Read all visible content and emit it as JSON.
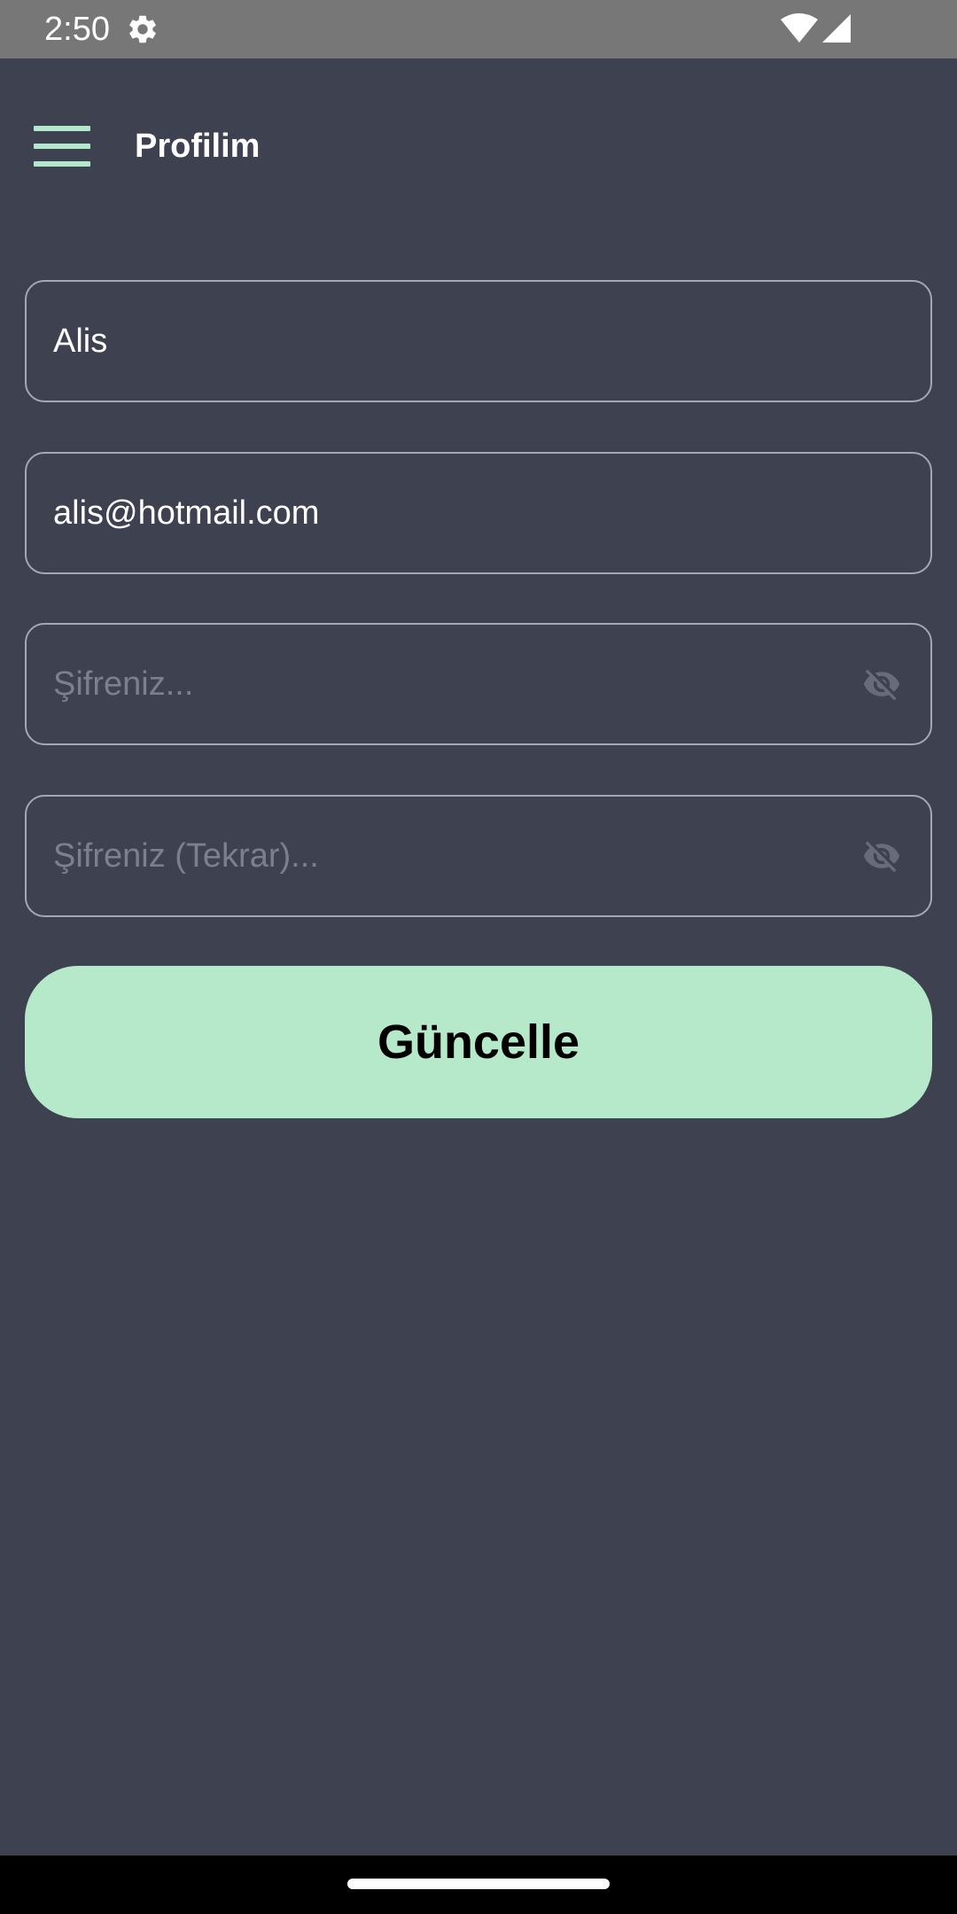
{
  "status_bar": {
    "time": "2:50",
    "icons": [
      "gear-icon",
      "wifi-icon",
      "cell-signal-icon"
    ]
  },
  "app_bar": {
    "title": "Profilim",
    "menu_icon": "hamburger-menu-icon"
  },
  "form": {
    "name_field": {
      "value": "Alis"
    },
    "email_field": {
      "value": "alis@hotmail.com"
    },
    "password_field": {
      "placeholder": "Şifreniz...",
      "icon": "eye-off-icon"
    },
    "password_confirm_field": {
      "placeholder": "Şifreniz (Tekrar)...",
      "icon": "eye-off-icon"
    },
    "submit_label": "Güncelle"
  },
  "colors": {
    "background": "#3d4150",
    "accent": "#b6e8ca",
    "field_border": "#a4a7b4",
    "placeholder": "#7b7f8e",
    "status_bar": "#777777"
  }
}
